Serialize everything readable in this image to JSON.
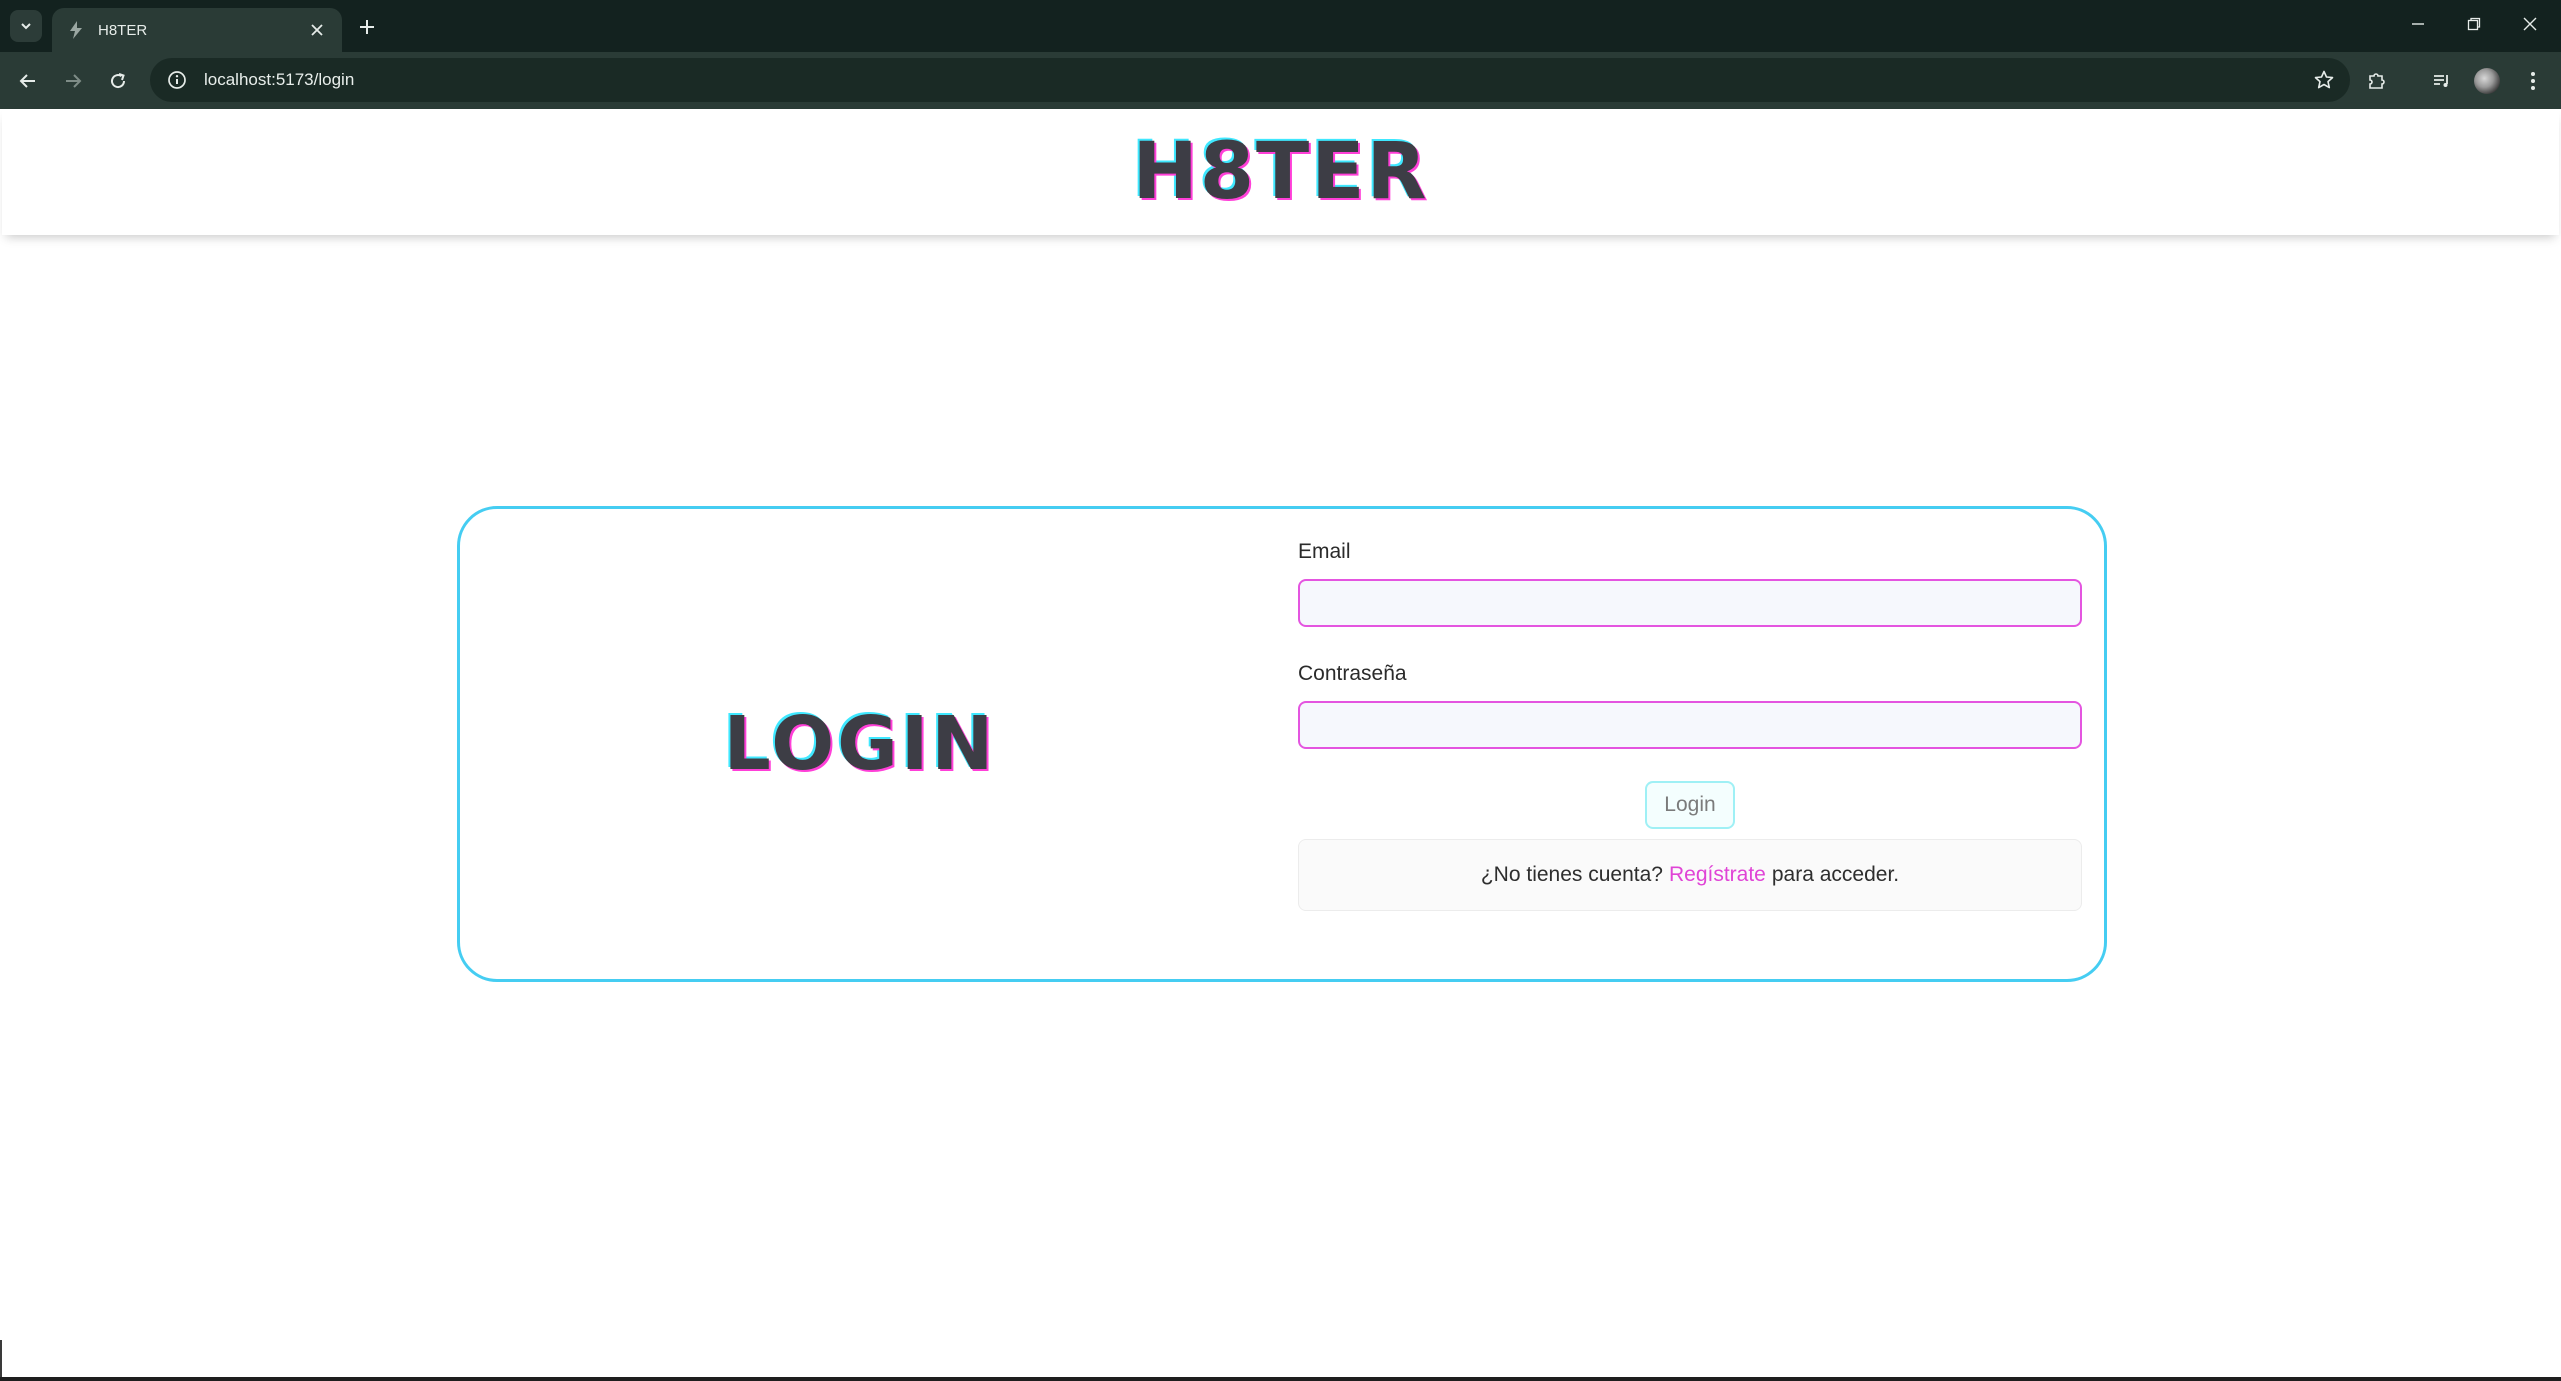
{
  "browser": {
    "tab_title": "H8TER",
    "url": "localhost:5173/login",
    "icons": {
      "tab_search": "chevron-down-icon",
      "favicon": "bolt-icon",
      "tab_close": "close-icon",
      "new_tab": "plus-icon",
      "back": "arrow-left-icon",
      "forward": "arrow-right-icon",
      "reload": "reload-icon",
      "site_info": "info-icon",
      "bookmark": "star-icon",
      "extensions": "puzzle-icon",
      "media": "playlist-icon",
      "menu": "kebab-menu-icon",
      "minimize": "minimize-icon",
      "restore": "restore-icon",
      "close_window": "close-icon"
    },
    "colors": {
      "tabstrip": "#13221f",
      "toolbar": "#2a3b36"
    }
  },
  "page": {
    "brand": "H8TER",
    "login_heading": "LOGIN",
    "form": {
      "email_label": "Email",
      "email_value": "",
      "password_label": "Contraseña",
      "password_value": "",
      "submit_label": "Login"
    },
    "register": {
      "prefix": "¿No tienes cuenta?",
      "link": "Regístrate",
      "suffix": "para acceder."
    },
    "colors": {
      "card_border": "#45cdf2",
      "input_border": "#e455e0",
      "link": "#e044d6",
      "logo_text": "#3d3d45",
      "logo_shadow_magenta": "#ff3fd8",
      "logo_shadow_cyan": "#3fe8ff"
    }
  }
}
